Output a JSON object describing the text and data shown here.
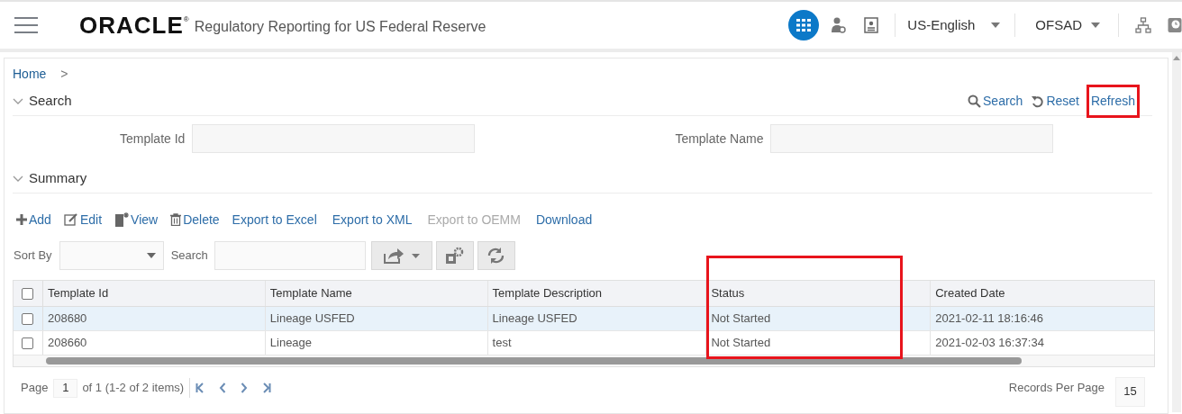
{
  "header": {
    "logo": "ORACLE",
    "logo_mark": "®",
    "app_title": "Regulatory Reporting for US Federal Reserve",
    "language": "US-English",
    "user": "OFSAD"
  },
  "breadcrumb": {
    "home": "Home",
    "separator": ">"
  },
  "search_section": {
    "title": "Search",
    "expanded": true,
    "actions": [
      "Search",
      "Reset",
      "Refresh"
    ],
    "fields": [
      {
        "label": "Template Id"
      },
      {
        "label": "Template Name"
      }
    ]
  },
  "summary_section": {
    "title": "Summary",
    "expanded": true,
    "actions": [
      {
        "label": "Add",
        "disabled": false
      },
      {
        "label": "Edit",
        "disabled": false
      },
      {
        "label": "View",
        "disabled": false
      },
      {
        "label": "Delete",
        "disabled": false
      },
      {
        "label": "Export to Excel",
        "disabled": false
      },
      {
        "label": "Export to XML",
        "disabled": false
      },
      {
        "label": "Export to OEMM",
        "disabled": true
      },
      {
        "label": "Download",
        "disabled": false
      }
    ],
    "sort_by_label": "Sort By",
    "search_label": "Search"
  },
  "table": {
    "select_all_checked": false,
    "columns": [
      "Template Id",
      "Template Name",
      "Template Description",
      "Status",
      "Created Date"
    ],
    "rows": [
      {
        "selected": true,
        "checked": false,
        "cells": [
          "208680",
          "Lineage USFED",
          "Lineage USFED",
          "Not Started",
          "2021-02-11 18:16:46"
        ]
      },
      {
        "selected": false,
        "checked": false,
        "cells": [
          "208660",
          "Lineage",
          "test",
          "Not Started",
          "2021-02-03 16:37:34"
        ]
      }
    ]
  },
  "pagination": {
    "page_label": "Page",
    "page": "1",
    "of_text": "of 1 (1-2 of 2 items)",
    "records_label": "Records Per Page",
    "records": "15"
  }
}
